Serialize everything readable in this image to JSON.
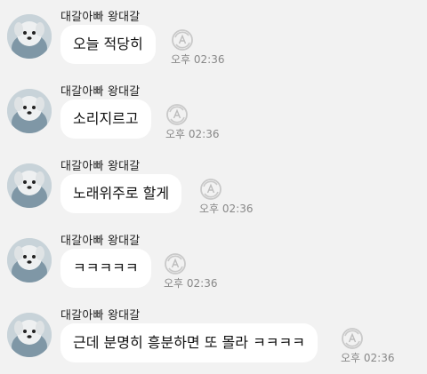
{
  "chat": {
    "messages": [
      {
        "sender": "대갈아빠 왕대갈",
        "text": "오늘 적당히",
        "time": "오후 02:36",
        "read_icon": "refresh-a-icon"
      },
      {
        "sender": "대갈아빠 왕대갈",
        "text": "소리지르고",
        "time": "오후 02:36",
        "read_icon": "refresh-a-icon"
      },
      {
        "sender": "대갈아빠 왕대갈",
        "text": "노래위주로 할게",
        "time": "오후 02:36",
        "read_icon": "refresh-a-icon"
      },
      {
        "sender": "대갈아빠 왕대갈",
        "text": "ㅋㅋㅋㅋㅋ",
        "time": "오후 02:36",
        "read_icon": "refresh-a-icon"
      },
      {
        "sender": "대갈아빠 왕대갈",
        "text": "근데 분명히 흥분하면 또 몰라 ㅋㅋㅋㅋ",
        "time": "오후 02:36",
        "read_icon": "refresh-a-icon"
      }
    ]
  },
  "colors": {
    "background": "#f2f2f2",
    "bubble": "#ffffff",
    "text": "#111111",
    "time": "#888888"
  }
}
